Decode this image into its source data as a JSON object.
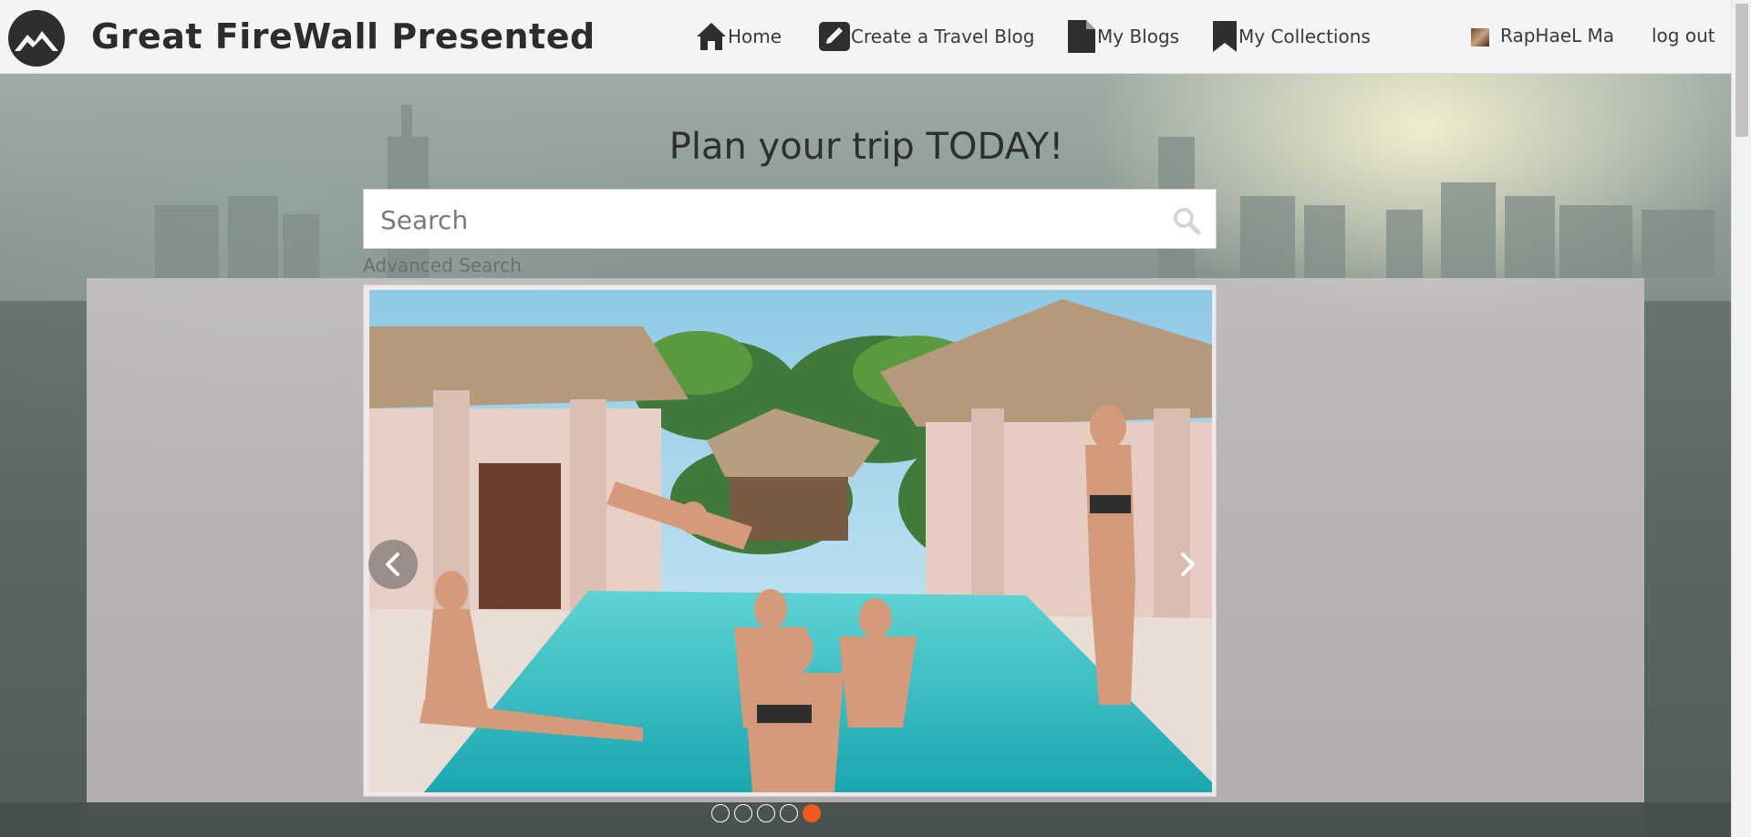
{
  "header": {
    "site_title": "Great FireWall Presented",
    "logo_icon": "mountain-logo-icon",
    "nav": [
      {
        "label": "Home",
        "icon": "home-icon"
      },
      {
        "label": "Create a Travel Blog",
        "icon": "pencil-icon"
      },
      {
        "label": "My Blogs",
        "icon": "document-icon"
      },
      {
        "label": "My Collections",
        "icon": "bookmark-icon"
      }
    ],
    "user": {
      "name": "RapHaeL Ma"
    },
    "logout_label": "log out"
  },
  "hero": {
    "title": "Plan your trip TODAY!",
    "search": {
      "placeholder": "Search",
      "value": ""
    },
    "advanced_search_label": "Advanced Search"
  },
  "carousel": {
    "total_slides": 5,
    "active_slide": 5,
    "active_dot_color": "#f05a1e",
    "prev_icon": "chevron-left-icon",
    "next_icon": "chevron-right-icon"
  }
}
